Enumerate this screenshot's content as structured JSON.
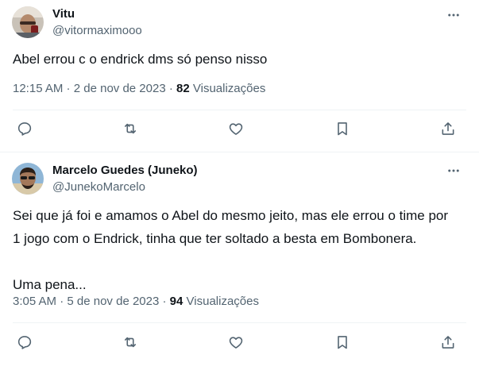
{
  "tweets": [
    {
      "name": "Vitu",
      "handle": "@vitormaximooo",
      "text_lines": [
        "Abel errou c o endrick dms só penso nisso"
      ],
      "time": "12:15 AM",
      "date": "2 de nov de 2023",
      "views_count": "82",
      "views_label": "Visualizações"
    },
    {
      "name": "Marcelo Guedes (Juneko)",
      "handle": "@JunekoMarcelo",
      "text_lines": [
        "Sei que já foi e amamos o Abel do mesmo jeito, mas ele errou o time por",
        "1 jogo com o Endrick, tinha que ter soltado a besta em Bombonera.",
        "Uma pena..."
      ],
      "time": "3:05 AM",
      "date": "5 de nov de 2023",
      "views_count": "94",
      "views_label": "Visualizações"
    }
  ],
  "separator": " · ",
  "icons": {
    "more": "more-dots-icon",
    "reply": "reply-icon",
    "retweet": "retweet-icon",
    "like": "heart-icon",
    "bookmark": "bookmark-icon",
    "share": "share-icon"
  },
  "colors": {
    "text": "#0f1419",
    "secondary": "#536471",
    "divider": "#eff3f4"
  }
}
